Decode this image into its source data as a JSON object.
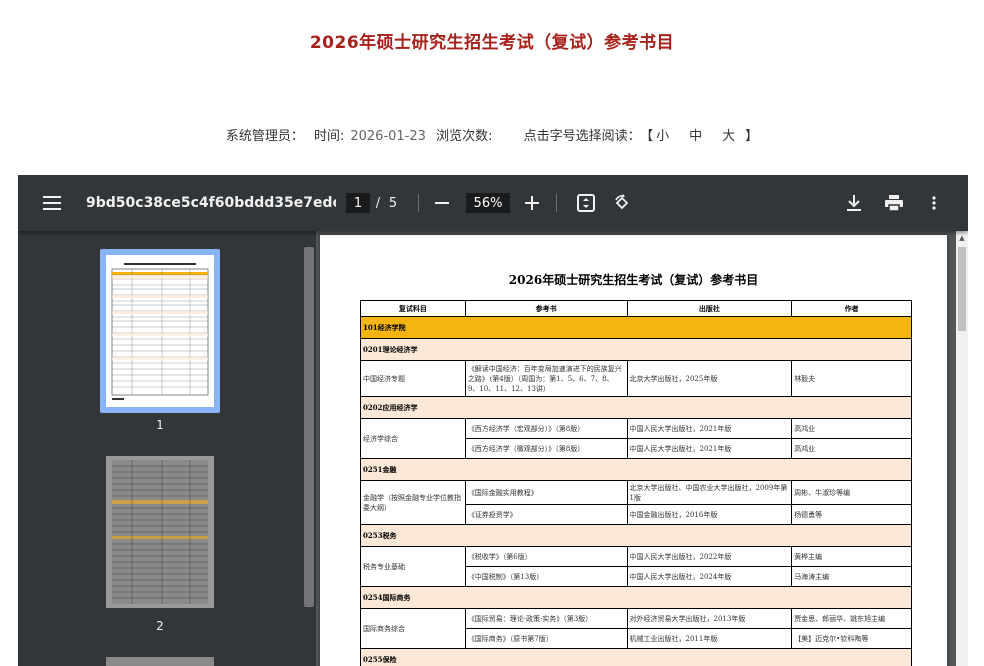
{
  "page": {
    "title": "2026年硕士研究生招生考试（复试）参考书目",
    "meta": {
      "admin_label": "系统管理员：",
      "time_label": "时间:",
      "time_value": "2026-01-23",
      "views_label": "浏览次数:",
      "font_label": "点击字号选择阅读：",
      "bracket_open": "【",
      "size_small": "小",
      "size_medium": "中",
      "size_large": "大",
      "bracket_close": "】"
    }
  },
  "viewer": {
    "filename": "9bd50c38ce5c4f60bddd35e7edc7cf...",
    "current_page": "1",
    "page_sep": "/",
    "total_pages": "5",
    "zoom": "56%",
    "icons": [
      "menu-icon",
      "zoom-out-icon",
      "zoom-in-icon",
      "fit-page-icon",
      "rotate-icon",
      "download-icon",
      "print-icon",
      "more-vert-icon"
    ],
    "colors": {
      "toolbar": "#323639",
      "background": "#525659",
      "selected_thumb": "#8ab4f8"
    },
    "thumbnails": [
      {
        "label": "1",
        "selected": true
      },
      {
        "label": "2",
        "selected": false
      }
    ]
  },
  "document": {
    "title": "2026年硕士研究生招生考试（复试）参考书目",
    "headers": [
      "复试科目",
      "参考书",
      "出版社",
      "作者"
    ],
    "colors": {
      "category": "#f6b413",
      "subcategory": "#fce8d6"
    },
    "rows": [
      {
        "type": "cat1",
        "text": "101经济学院"
      },
      {
        "type": "cat2",
        "text": "0201理论经济学"
      },
      {
        "type": "data",
        "subject": "中国经济专题",
        "book": "《解读中国经济：百年变局加速演进下的民族复兴之路》（第4版）（周国为：第1、5、6、7、8、9、10、11、12、13讲）",
        "publisher": "北京大学出版社，2025年版",
        "author": "林毅夫"
      },
      {
        "type": "cat2",
        "text": "0202应用经济学"
      },
      {
        "type": "data",
        "subject": "经济学综合",
        "book": "《西方经济学（宏观部分）》（第8版）",
        "publisher": "中国人民大学出版社，2021年版",
        "author": "高鸿业"
      },
      {
        "type": "data",
        "subject": "",
        "book": "《西方经济学（微观部分）》（第8版）",
        "publisher": "中国人民大学出版社，2021年版",
        "author": "高鸿业"
      },
      {
        "type": "cat2",
        "text": "0251金融"
      },
      {
        "type": "data",
        "subject": "金融学（按照金融专业学位教指委大纲）",
        "book": "《国际金融实用教程》",
        "publisher": "北京大学出版社、中国农业大学出版社，2009年第1版",
        "author": "周彬、牛淑珍等编"
      },
      {
        "type": "data",
        "subject": "",
        "book": "《证券投资学》",
        "publisher": "中国金融出版社，2016年版",
        "author": "杨德勇等"
      },
      {
        "type": "cat2",
        "text": "0253税务"
      },
      {
        "type": "data",
        "subject": "税务专业基础",
        "book": "《税收学》（第6版）",
        "publisher": "中国人民大学出版社，2022年版",
        "author": "黄桦主编"
      },
      {
        "type": "data",
        "subject": "",
        "book": "《中国税制》（第13版）",
        "publisher": "中国人民大学出版社，2024年版",
        "author": "马海涛主编"
      },
      {
        "type": "cat2",
        "text": "0254国际商务"
      },
      {
        "type": "data",
        "subject": "国际商务综合",
        "book": "《国际贸易：理论·政策·实务》（第3版）",
        "publisher": "对外经济贸易大学出版社，2013年版",
        "author": "贾金思、郎丽华、姚东旭主编"
      },
      {
        "type": "data",
        "subject": "",
        "book": "《国际商务》（原书第7版）",
        "publisher": "机械工业出版社，2011年版",
        "author": "【美】迈克尔•钦科陶等"
      },
      {
        "type": "cat2",
        "text": "0255保险"
      }
    ]
  }
}
